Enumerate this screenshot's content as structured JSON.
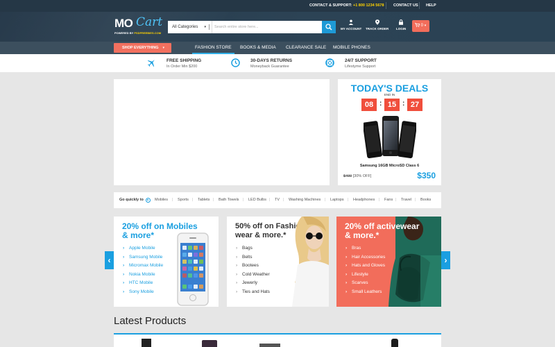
{
  "topbar": {
    "contact_label": "CONTACT & SUPPORT:",
    "phone": "+1 800 1234 5678",
    "contact_us": "CONTACT US",
    "help": "HELP"
  },
  "logo": {
    "mo": "MO",
    "cart": "Cart",
    "powered_prefix": "POWERED BY",
    "powered_brand": "PSDFREEBIES.COM"
  },
  "search": {
    "category": "All Categories",
    "placeholder": "Search entire store here..."
  },
  "header_actions": [
    {
      "label": "MY ACCOUNT",
      "icon": "user-icon"
    },
    {
      "label": "TRACK ORDER",
      "icon": "map-pin-icon"
    },
    {
      "label": "LOGIN",
      "icon": "lock-icon"
    }
  ],
  "cart": {
    "count": "0"
  },
  "nav": {
    "shop_everything": "SHOP EVERYTHING",
    "items": [
      "FASHION STORE",
      "BOOKS & MEDIA",
      "CLEARANCE SALE",
      "MOBILE PHONES"
    ],
    "active_index": 0
  },
  "features": [
    {
      "icon": "plane-icon",
      "title": "FREE SHIPPING",
      "subtitle": "In Order Min $200"
    },
    {
      "icon": "clock-icon",
      "title": "30-DAYS RETURNS",
      "subtitle": "Moneyback Guarantee"
    },
    {
      "icon": "lifebuoy-icon",
      "title": "24/7 SUPPORT",
      "subtitle": "Lifestyme Support"
    }
  ],
  "deals": {
    "title": "TODAY'S DEALS",
    "end_in": "END IN",
    "timer": [
      "08",
      "15",
      "27"
    ],
    "product_name": "Samsung 16GB MicroSD Class 6",
    "old_price": "$499",
    "discount": "[30% OFF]",
    "new_price": "$350"
  },
  "quick_links": {
    "label": "Go quickly to",
    "links": [
      "Mobiles",
      "Sports",
      "Tablets",
      "Bath Towels",
      "LED Bulbs",
      "TV",
      "Washing Machines",
      "Laptops",
      "Headphones",
      "Fans",
      "Travel",
      "Books"
    ]
  },
  "promos": [
    {
      "title1": "20% off on Mobiles",
      "title2": "& more*",
      "items": [
        "Apple Mobile",
        "Samsung Mobile",
        "Micromax Mobile",
        "Nokia Mobile",
        "HTC Mobile",
        "Sony Mobile"
      ]
    },
    {
      "title1": "50% off on Fashion",
      "title2": "wear & more.*",
      "items": [
        "Bags",
        "Belts",
        "Bootees",
        "Cold Weather",
        "Jewerly",
        "Ties and Hats"
      ]
    },
    {
      "title1": "20% off activewear",
      "title2": "& more.*",
      "items": [
        "Bras",
        "Hair Accessories",
        "Hats and Gloves",
        "Lifestyle",
        "Scarves",
        "Small Leathers"
      ]
    }
  ],
  "carousel": {
    "prev": "‹",
    "next": "›"
  },
  "latest_products": {
    "title": "Latest Products"
  },
  "colors": {
    "accent": "#1a9fe0",
    "coral": "#f26d5b",
    "header": "#2c4355",
    "nav": "#3c4f5e",
    "timer": "#f04e3c",
    "phone_yellow": "#ffd200"
  }
}
